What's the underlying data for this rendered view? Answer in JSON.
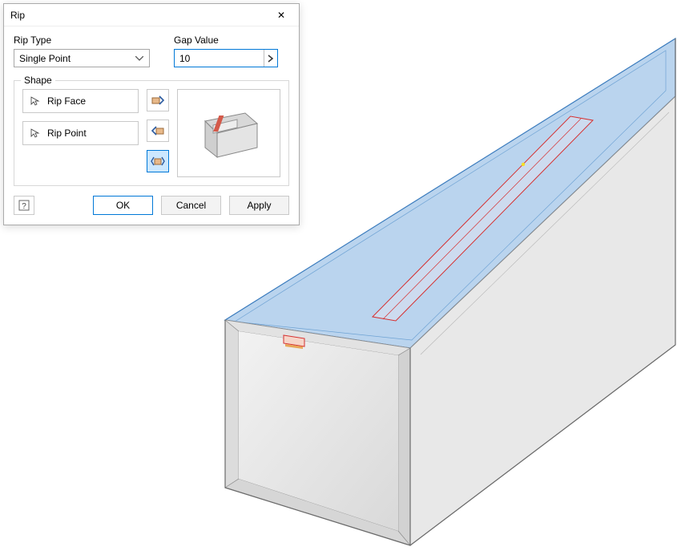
{
  "dialog": {
    "title": "Rip",
    "rip_type_label": "Rip Type",
    "rip_type_value": "Single Point",
    "gap_value_label": "Gap Value",
    "gap_value": "10",
    "shape_label": "Shape",
    "rip_face_label": "Rip Face",
    "rip_point_label": "Rip Point",
    "ok": "OK",
    "cancel": "Cancel",
    "apply": "Apply"
  },
  "icons": {
    "close": "✕",
    "chevron_down": "▾",
    "chevron_right": "›",
    "help": "?"
  },
  "colors": {
    "accent": "#0078d7",
    "selection_face": "#a9c7e8",
    "selection_edge": "#2a6fb5",
    "rip_outline": "#d62f2f",
    "model_fill": "#e6e6e6",
    "model_edge": "#888"
  }
}
